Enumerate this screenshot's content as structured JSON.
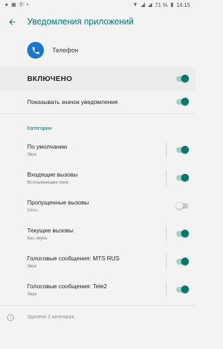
{
  "status_bar": {
    "battery": "71 %",
    "time": "14:15"
  },
  "appbar": {
    "title": "Уведомления приложений"
  },
  "app": {
    "name": "Телефон"
  },
  "master": {
    "label": "ВКЛЮЧЕНО",
    "enabled": true
  },
  "badge_row": {
    "label": "Показывать значок уведомления",
    "enabled": true
  },
  "categories": {
    "header": "Категории",
    "items": [
      {
        "title": "По умолчанию",
        "subtitle": "Звук",
        "enabled": true
      },
      {
        "title": "Входящие вызовы",
        "subtitle": "Всплывающее окно",
        "enabled": true
      },
      {
        "title": "Пропущенные вызовы",
        "subtitle": "Откл.",
        "enabled": false
      },
      {
        "title": "Текущие вызовы",
        "subtitle": "Без звука",
        "enabled": true
      },
      {
        "title": "Голосовые сообщения: MTS RUS",
        "subtitle": "Звук",
        "enabled": true
      },
      {
        "title": "Голосовые сообщения: Tele2",
        "subtitle": "Звук",
        "enabled": true
      }
    ]
  },
  "footer": {
    "text": "Удалено 2 категории"
  },
  "colors": {
    "accent": "#00796b",
    "app_icon": "#1976d2"
  }
}
